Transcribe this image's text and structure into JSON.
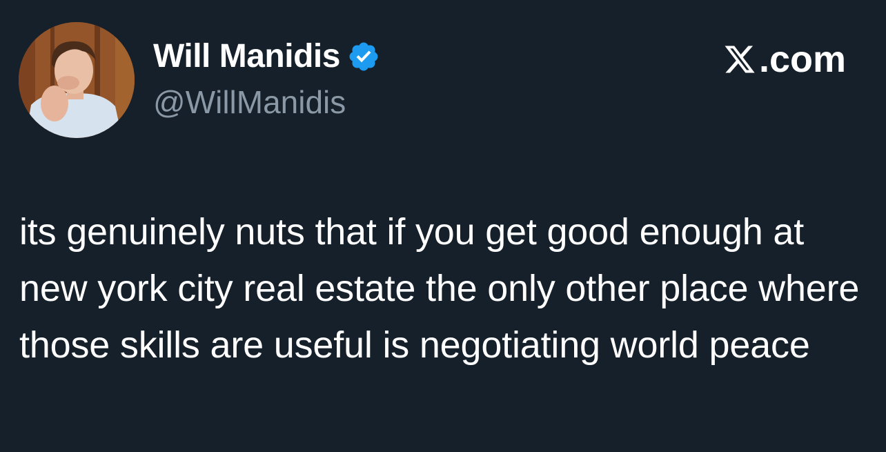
{
  "author": {
    "display_name": "Will Manidis",
    "handle": "@WillManidis",
    "verified": true,
    "verified_color": "#1d9bf0",
    "avatar_icon": "profile-photo"
  },
  "brand": {
    "label": ".com",
    "icon": "x-logo-icon"
  },
  "tweet": {
    "text": "its genuinely nuts that if you get good enough at new york city real estate the only other place where those skills are useful is negotiating world peace"
  },
  "colors": {
    "background": "#15202b",
    "primary_text": "#ffffff",
    "secondary_text": "#8b98a5"
  }
}
